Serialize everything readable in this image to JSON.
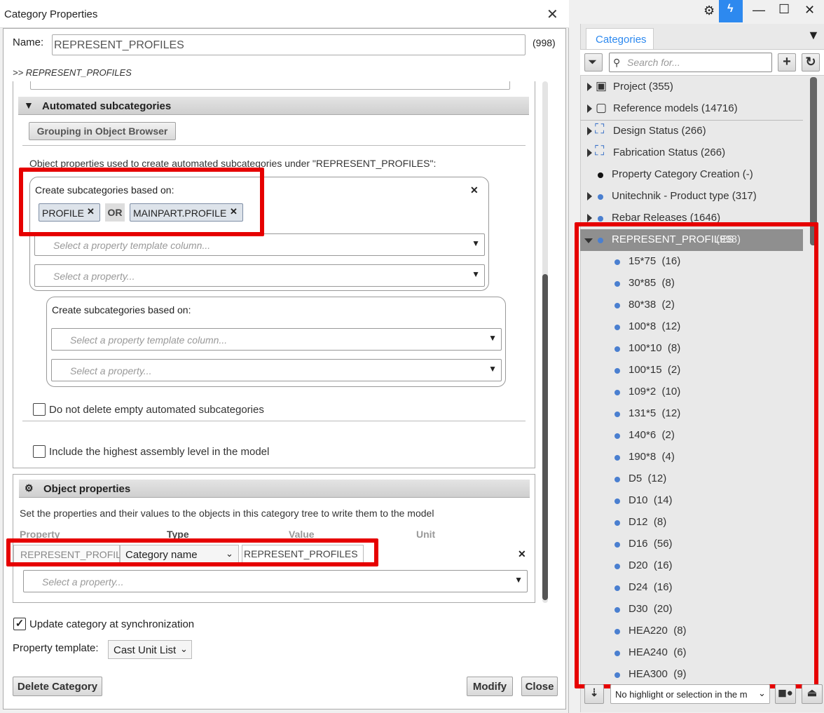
{
  "dialog": {
    "title": "Category Properties",
    "name_label": "Name:",
    "name_value": "REPRESENT_PROFILES",
    "name_count": "(998)",
    "breadcrumb": ">> REPRESENT_PROFILES",
    "auto_sub": {
      "header": "Automated subcategories",
      "grouping_button": "Grouping in Object Browser",
      "description": "Object properties used to create automated subcategories under \"REPRESENT_PROFILES\":",
      "group1": {
        "label": "Create subcategories based on:",
        "chips": [
          "PROFILE",
          "MAINPART.PROFILE"
        ],
        "or_label": "OR",
        "column_placeholder": "Select a property template column...",
        "property_placeholder": "Select a property..."
      },
      "group2": {
        "label": "Create subcategories based on:",
        "column_placeholder": "Select a property template column...",
        "property_placeholder": "Select a property..."
      },
      "no_delete_label": "Do not delete empty automated subcategories",
      "include_highest_label": "Include the highest assembly level in the model"
    },
    "obj_props": {
      "header": "Object properties",
      "description": "Set the properties and their values to the objects in this category tree to write them to the model",
      "col_property": "Property",
      "col_type": "Type",
      "col_value": "Value",
      "col_unit": "Unit",
      "row": {
        "property": "REPRESENT_PROFILE",
        "type": "Category name",
        "value": "REPRESENT_PROFILES"
      },
      "add_placeholder": "Select a property..."
    },
    "update_sync_label": "Update category at synchronization",
    "template_label": "Property template:",
    "template_value": "Cast Unit List",
    "delete_button": "Delete Category",
    "modify_button": "Modify",
    "close_button": "Close"
  },
  "panel": {
    "tab": "Categories",
    "search_placeholder": "Search for...",
    "tree": [
      {
        "label": "Project (355)",
        "icon": "cube-icon"
      },
      {
        "label": "Reference models (14716)",
        "icon": "cube-outline-icon"
      },
      {
        "label": "Design Status (266)",
        "icon": "node-square-icon"
      },
      {
        "label": "Fabrication Status (266)",
        "icon": "node-square-icon"
      },
      {
        "label": "Property Category Creation (-)",
        "icon": "black-dot-icon"
      },
      {
        "label": "Unitechnik - Product type (317)",
        "icon": "blue-dot-icon"
      },
      {
        "label": "Rebar Releases (1646)",
        "icon": "blue-dot-icon"
      }
    ],
    "selected": {
      "label": "REPRESENT_PROFILES",
      "count": "(998)"
    },
    "children": [
      "15*75  (16)",
      "30*85  (8)",
      "80*38  (2)",
      "100*8  (12)",
      "100*10  (8)",
      "100*15  (2)",
      "109*2  (10)",
      "131*5  (12)",
      "140*6  (2)",
      "190*8  (4)",
      "D5  (12)",
      "D10  (14)",
      "D12  (8)",
      "D16  (56)",
      "D20  (16)",
      "D24  (16)",
      "D30  (20)",
      "HEA220  (8)",
      "HEA240  (6)",
      "HEA300  (9)"
    ],
    "highlight_select": "No highlight or selection in the m"
  },
  "colors": {
    "accent": "#2d89ef",
    "highlight_red": "#e60000",
    "selected_row": "#8f8f8f",
    "tree_dot": "#4a7fd0"
  }
}
